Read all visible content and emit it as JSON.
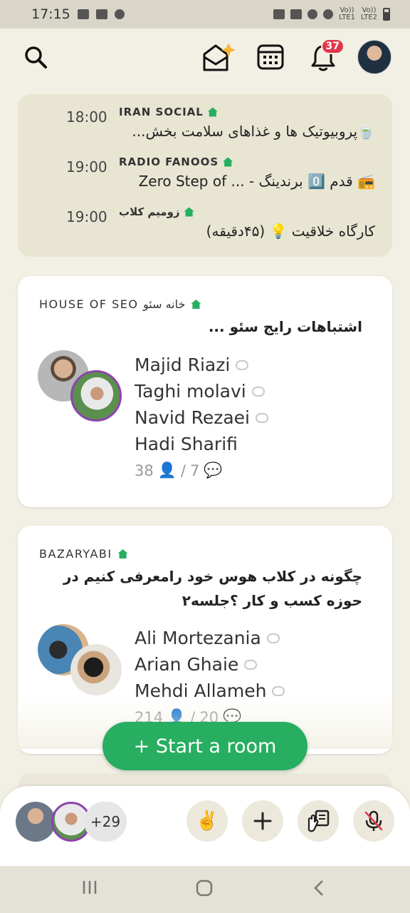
{
  "status_bar": {
    "time": "17:15",
    "sim1": "LTE1",
    "sim2": "LTE2",
    "volte": "Vo))"
  },
  "header": {
    "notifications_count": "37"
  },
  "schedule": [
    {
      "time": "18:00",
      "club": "IRAN SOCIAL",
      "title": "🍵پروبیوتیک ها و غذاهای سلامت بخش..."
    },
    {
      "time": "19:00",
      "club": "RADIO FANOOS",
      "title": "📻 قدم 0️⃣ برندینگ  -  ... Zero Step of"
    },
    {
      "time": "19:00",
      "club": "زومیم کلاب",
      "title": "کارگاه خلاقیت 💡 (۴۵دقیقه)"
    }
  ],
  "rooms": [
    {
      "club": "HOUSE OF SEO خانه سئو",
      "title": "اشتباهات رایج سئو ...",
      "speakers": [
        "Majid Riazi",
        "Taghi molavi",
        "Navid Rezaei",
        "Hadi Sharifi"
      ],
      "listeners": "38",
      "chats": "7"
    },
    {
      "club": "BAZARYABI",
      "title": "چگونه در کلاب هوس خود رامعرفی کنیم در حوزه کسب و کار ؟جلسه۲",
      "speakers": [
        "Ali Mortezania",
        "Arian Ghaie",
        "Mehdi Allameh"
      ],
      "listeners": "214",
      "chats": "20"
    }
  ],
  "start_room": {
    "label": "+ Start a room"
  },
  "bottom_bar": {
    "more_count": "+29",
    "peace_emoji": "✌️"
  },
  "colors": {
    "accent_green": "#27ae60",
    "badge_red": "#e0364a",
    "background": "#f2f0e4"
  }
}
